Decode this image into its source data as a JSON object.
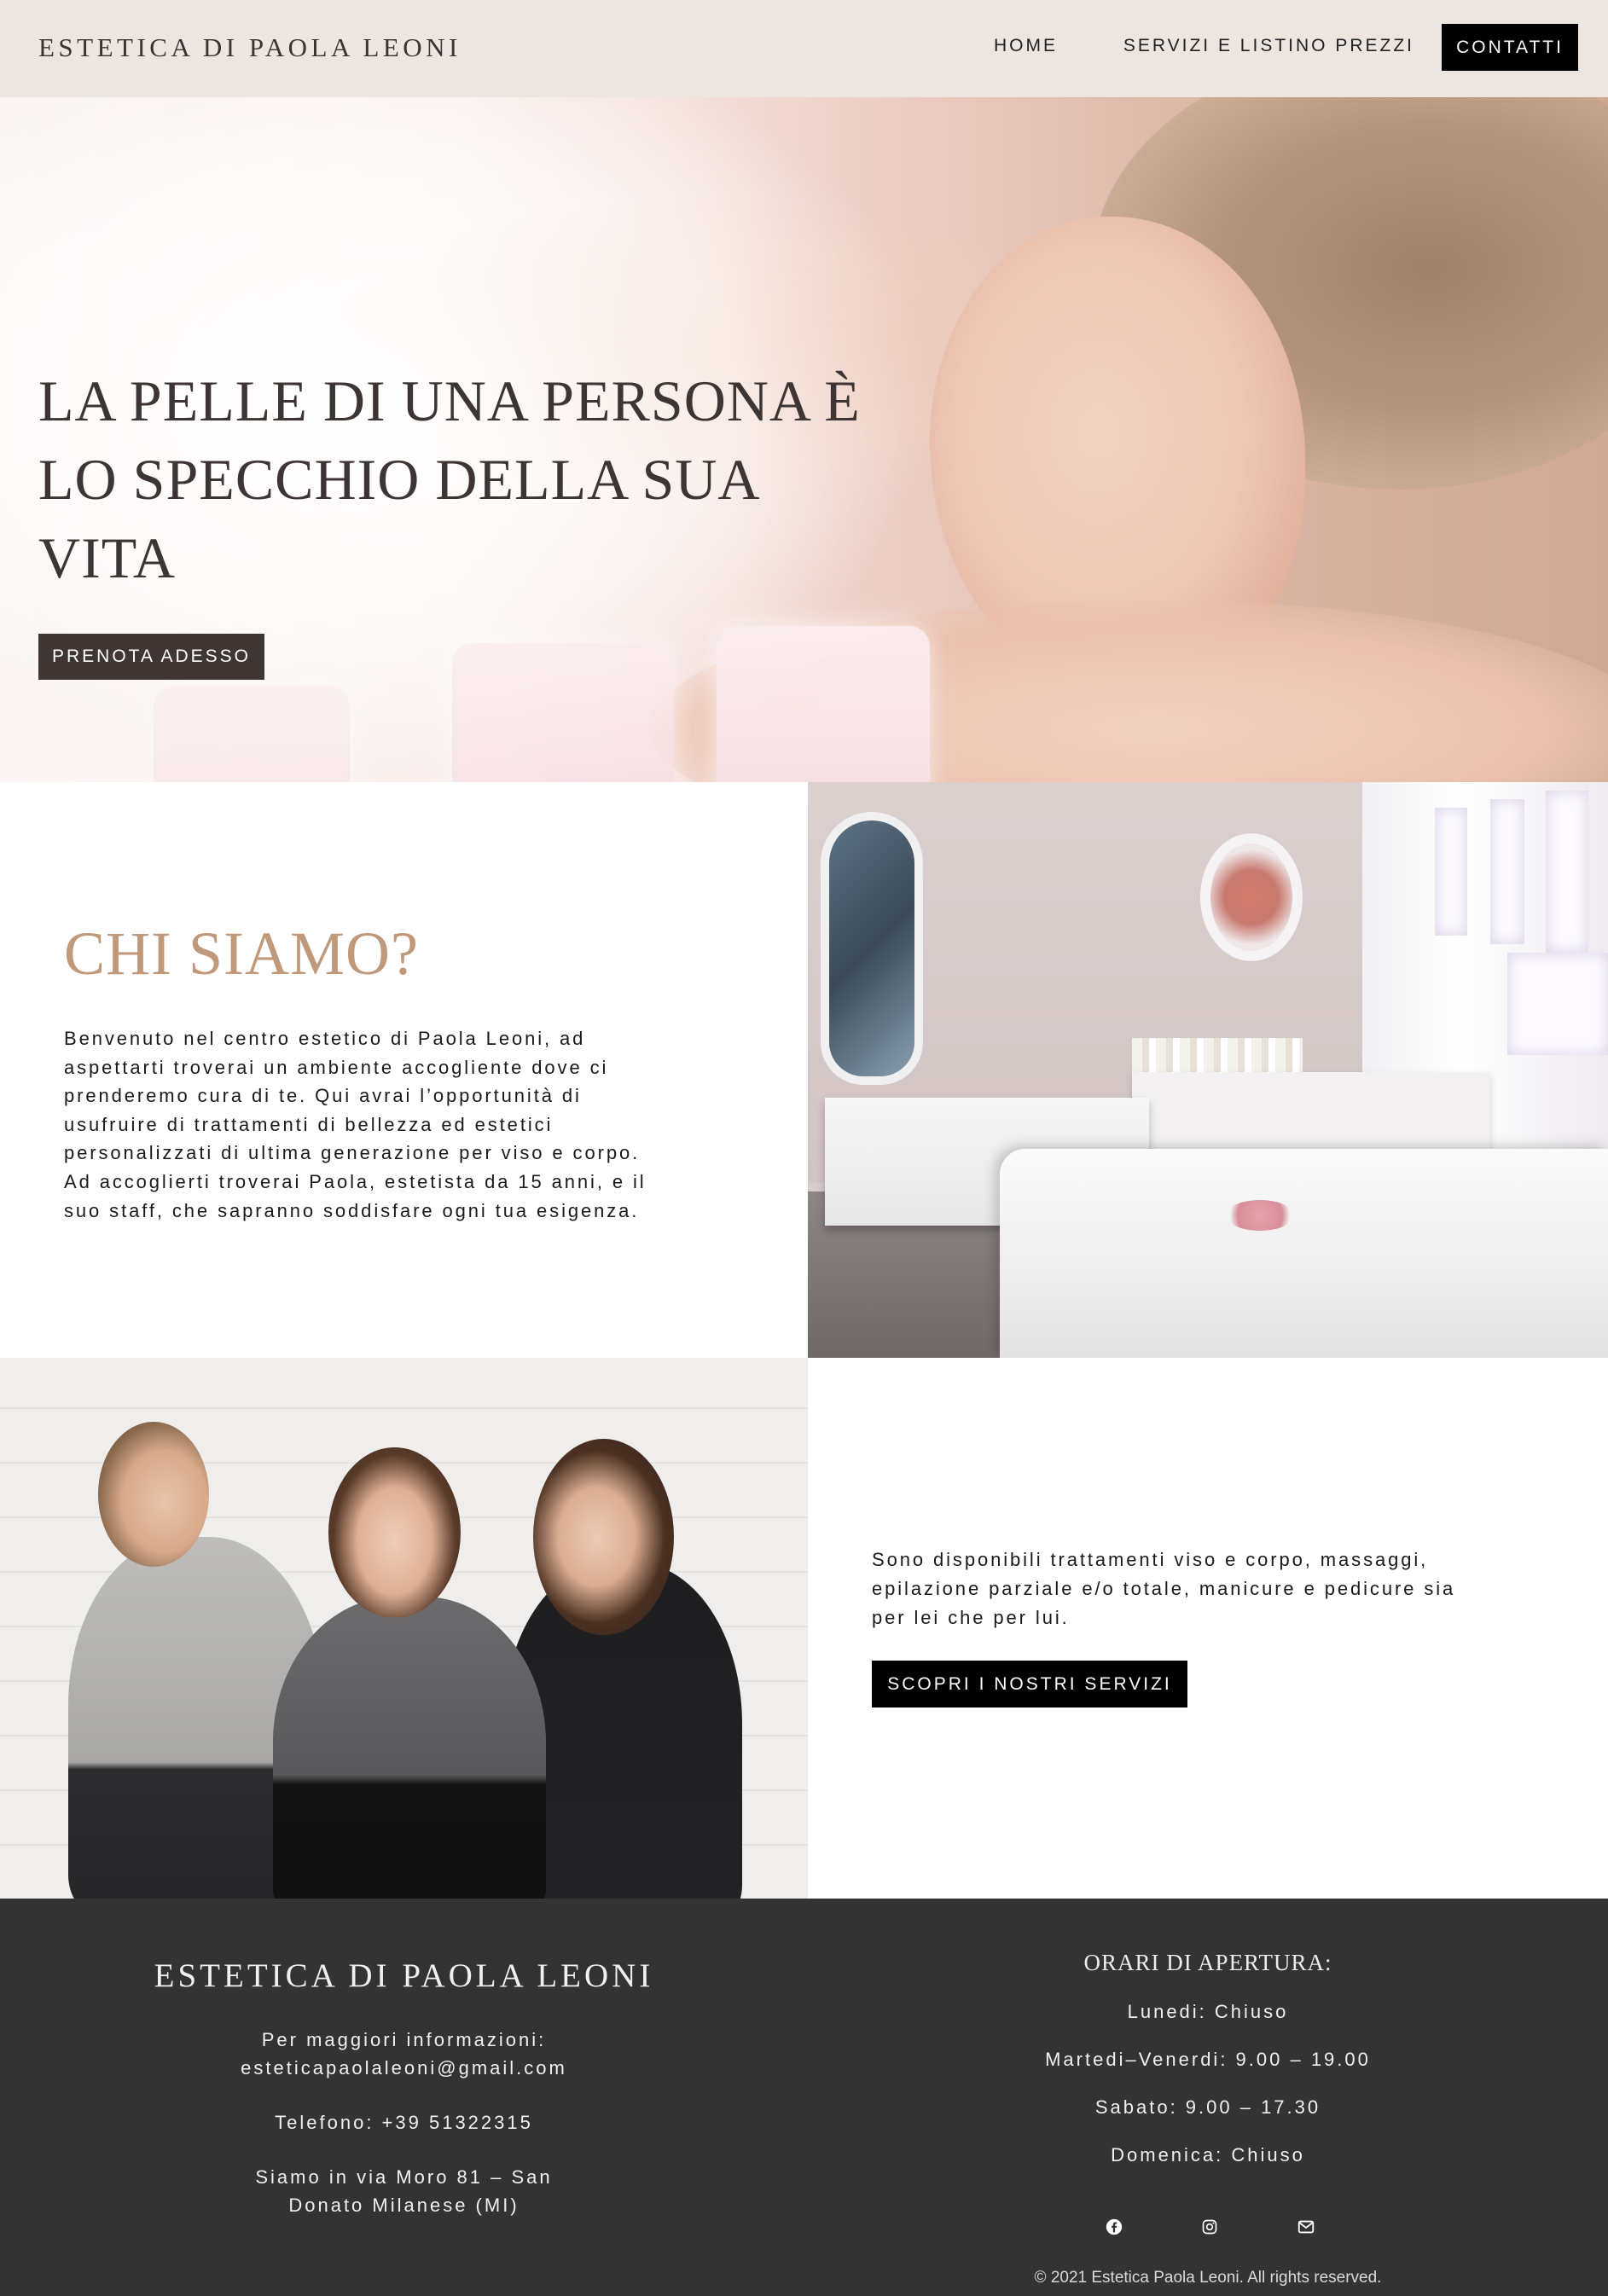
{
  "header": {
    "logo": "ESTETICA DI PAOLA LEONI",
    "nav": {
      "home": "HOME",
      "servizi": "SERVIZI E LISTINO PREZZI",
      "contatti": "CONTATTI"
    }
  },
  "hero": {
    "title_lines": [
      "LA PELLE DI UNA PERSONA È",
      "LO SPECCHIO DELLA SUA",
      "VITA"
    ],
    "cta": "PRENOTA ADESSO"
  },
  "chi_siamo": {
    "title": "CHI SIAMO?",
    "text_lines": [
      "Benvenuto nel centro estetico di Paola Leoni, ad",
      "aspettarti troverai un ambiente accogliente dove ci",
      "prenderemo cura di te. Qui avrai l’opportunità di",
      "usufruire di trattamenti di bellezza ed estetici",
      "personalizzati di ultima generazione per viso e corpo.",
      "Ad accoglierti troverai Paola, estetista da 15 anni, e il",
      "suo staff, che sapranno soddisfare ogni tua esigenza."
    ]
  },
  "servizi": {
    "text_lines": [
      "Sono disponibili trattamenti viso e corpo, massaggi,",
      "epilazione parziale e/o totale, manicure e pedicure sia",
      "per lei che per lui."
    ],
    "cta": "SCOPRI I NOSTRI SERVIZI"
  },
  "footer": {
    "logo": "ESTETICA DI PAOLA LEONI",
    "info_label": "Per maggiori informazioni:",
    "email": "esteticapaolaleoni@gmail.com",
    "phone": "Telefono: +39 51322315",
    "address_lines": [
      "Siamo in via Moro 81 – San",
      "Donato Milanese (MI)"
    ],
    "hours_title": "ORARI DI APERTURA:",
    "hours": [
      "Lunedi: Chiuso",
      "Martedi–Venerdi: 9.00 – 19.00",
      "Sabato: 9.00 – 17.30",
      "Domenica: Chiuso"
    ],
    "social_icons": [
      "facebook-icon",
      "instagram-icon",
      "mail-icon"
    ],
    "copyright": "© 2021 Estetica Paola Leoni. All rights reserved."
  }
}
